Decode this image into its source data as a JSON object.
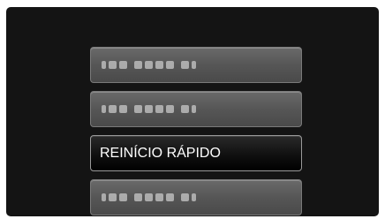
{
  "menu": {
    "items": [
      {
        "label": "",
        "placeholder": true,
        "selected": false
      },
      {
        "label": "",
        "placeholder": true,
        "selected": false
      },
      {
        "label": "REINÍCIO RÁPIDO",
        "placeholder": false,
        "selected": true
      },
      {
        "label": "",
        "placeholder": true,
        "selected": false
      }
    ]
  },
  "colors": {
    "screen_background": "#141414",
    "item_background": "#5a5a5a",
    "selected_background": "#000000",
    "text": "#ffffff"
  }
}
